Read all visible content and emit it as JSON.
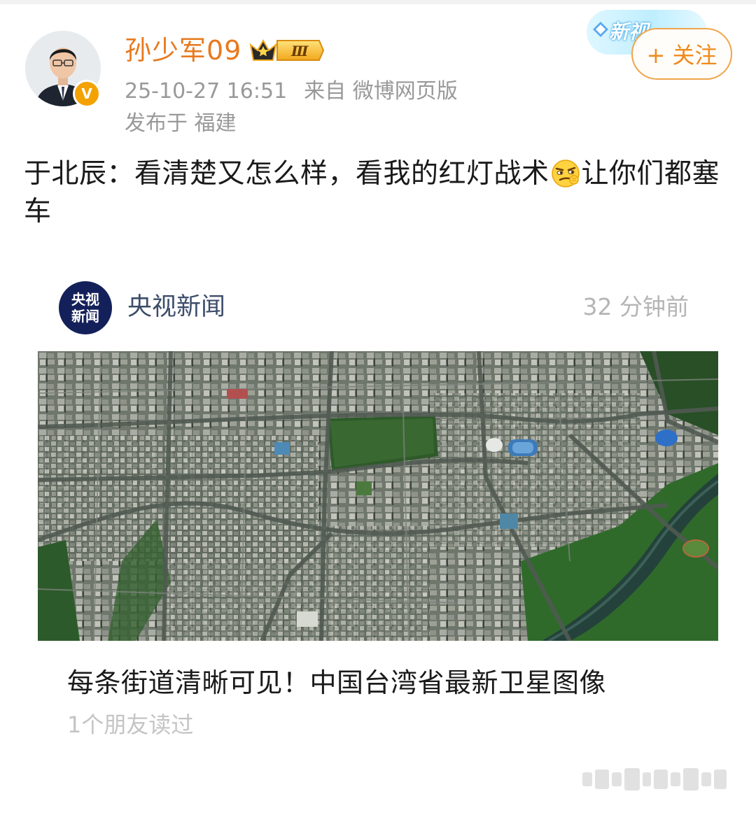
{
  "post": {
    "author": {
      "name": "孙少军09",
      "vip_level": "Ⅲ",
      "verified_mark": "V"
    },
    "timestamp": "25-10-27 16:51",
    "source": "来自 微博网页版",
    "location": "发布于 福建",
    "follow_label": "+ 关注",
    "promo_badge": "新视",
    "text_before_emoji": "于北辰：看清楚又怎么样，看我的红灯战术",
    "text_after_emoji": "让你们都塞车"
  },
  "embedded_card": {
    "logo_line1": "央视",
    "logo_line2": "新闻",
    "source_name": "央视新闻",
    "time_ago": "32 分钟前",
    "title": "每条街道清晰可见！中国台湾省最新卫星图像",
    "read_count": "1个朋友读过"
  },
  "colors": {
    "username": "#e8791e",
    "follow_border": "#f0a44a",
    "meta_text": "#999999",
    "source_name": "#3d4d6a"
  },
  "icons": [
    "avatar-photo",
    "verified-icon",
    "vip-crown-icon",
    "emoji-smirk-icon",
    "satellite-map-image"
  ]
}
